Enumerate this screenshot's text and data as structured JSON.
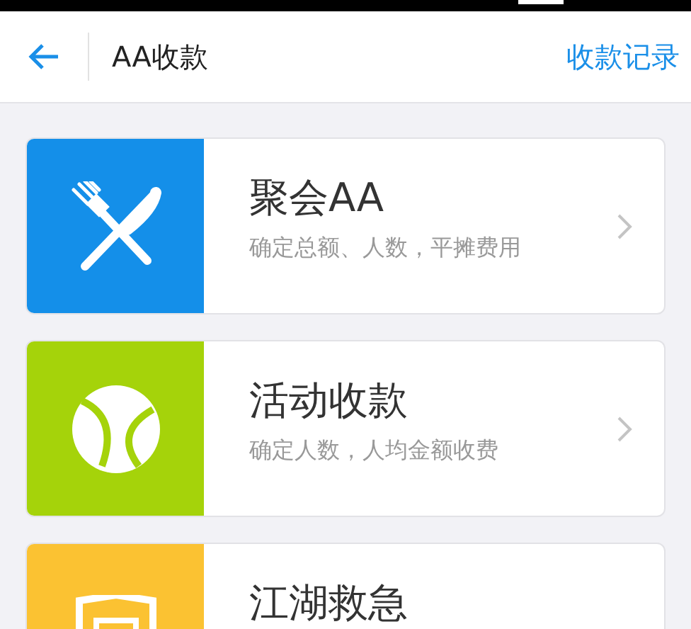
{
  "header": {
    "title": "AA收款",
    "action": "收款记录"
  },
  "cards": [
    {
      "kind": "cutlery",
      "color": "#148fe9",
      "title": "聚会AA",
      "subtitle": "确定总额、人数，平摊费用"
    },
    {
      "kind": "ball",
      "color": "#a5d30a",
      "title": "活动收款",
      "subtitle": "确定人数，人均金额收费"
    },
    {
      "kind": "badge",
      "color": "#fbc232",
      "title": "江湖救急"
    }
  ]
}
